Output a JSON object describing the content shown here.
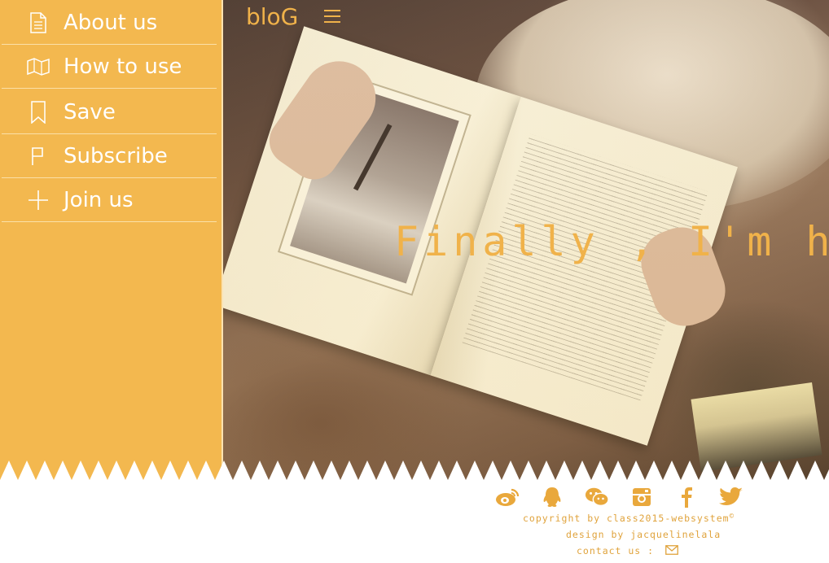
{
  "brand": {
    "name": "bloG"
  },
  "menu": [
    {
      "label": "About us",
      "icon": "document-icon"
    },
    {
      "label": "How to use",
      "icon": "map-icon"
    },
    {
      "label": "Save",
      "icon": "bookmark-icon"
    },
    {
      "label": "Subscribe",
      "icon": "flag-icon"
    },
    {
      "label": "Join us",
      "icon": "plus-icon"
    }
  ],
  "hero": {
    "tagline": "Finally , I'm here"
  },
  "footer": {
    "social": [
      "weibo-icon",
      "qq-icon",
      "wechat-icon",
      "instagram-icon",
      "facebook-icon",
      "twitter-icon"
    ],
    "copyright": "copyright by class2015-websystem",
    "copyright_mark": "©",
    "design": "design by jacquelinelala",
    "contact": "contact us :"
  },
  "colors": {
    "accent": "#f3b84f",
    "text_accent": "#e0a33c",
    "white": "#ffffff"
  }
}
